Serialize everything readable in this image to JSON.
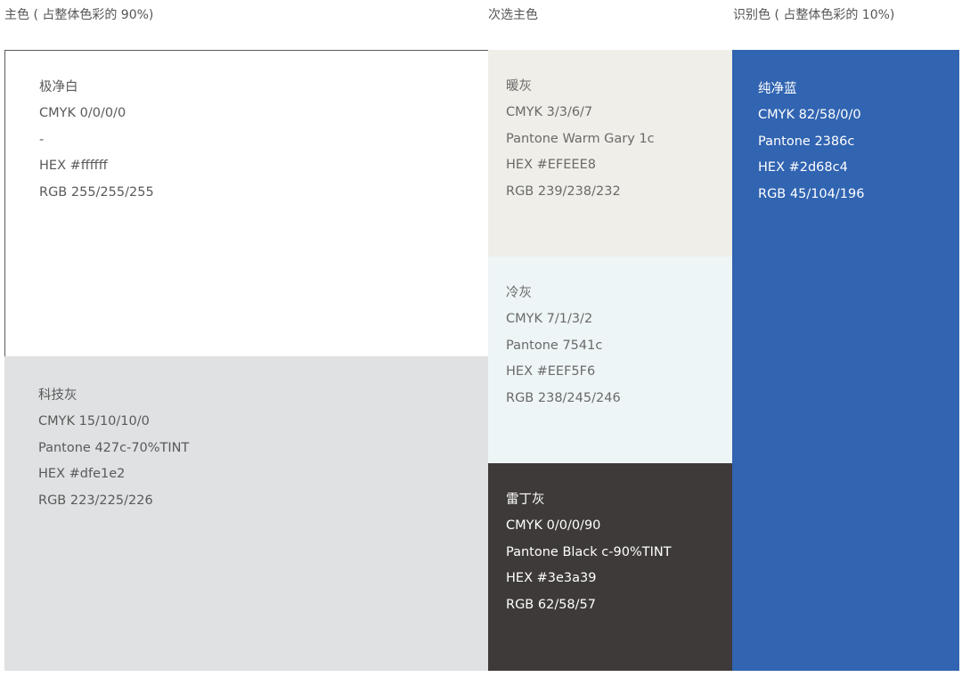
{
  "headers": {
    "primary": "主色 ( 占整体色彩的 90%)",
    "secondary": "次选主色",
    "identity": "识别色 ( 占整体色彩的 10%)"
  },
  "swatches": {
    "white": {
      "name": "极净白",
      "cmyk": "CMYK  0/0/0/0",
      "pantone": "-",
      "hex": "HEX  #ffffff",
      "rgb": "RGB  255/255/255",
      "bg": "#ffffff",
      "text_color": "#5a5a5a"
    },
    "tech": {
      "name": "科技灰",
      "cmyk": "CMYK  15/10/10/0",
      "pantone": "Pantone 427c-70%TINT",
      "hex": "HEX   #dfe1e2",
      "rgb": "RGB  223/225/226",
      "bg": "#dfe1e2",
      "text_color": "#5a5a5a"
    },
    "warm": {
      "name": "暖灰",
      "cmyk": "CMYK  3/3/6/7",
      "pantone": "Pantone Warm Gary 1c",
      "hex": "HEX  #EFEEE8",
      "rgb": "RGB  239/238/232",
      "bg": "#efeee8",
      "text_color": "#6a6a6a"
    },
    "cool": {
      "name": "冷灰",
      "cmyk": "CMYK  7/1/3/2",
      "pantone": "Pantone 7541c",
      "hex": "HEX  #EEF5F6",
      "rgb": "RGB  238/245/246",
      "bg": "#eef5f6",
      "text_color": "#6a6a6a"
    },
    "raiding": {
      "name": "雷丁灰",
      "cmyk": "CMYK  0/0/0/90",
      "pantone": "Pantone Black c-90%TINT",
      "hex": "HEX  #3e3a39",
      "rgb": "RGB  62/58/57",
      "bg": "#3e3a39",
      "text_color": "#ffffff"
    },
    "blue": {
      "name": "纯净蓝",
      "cmyk": "CMYK  82/58/0/0",
      "pantone": "Pantone 2386c",
      "hex": "HEX  #2d68c4",
      "rgb": "RGB  45/104/196",
      "bg": "#3164b1",
      "text_color": "#ffffff"
    }
  }
}
